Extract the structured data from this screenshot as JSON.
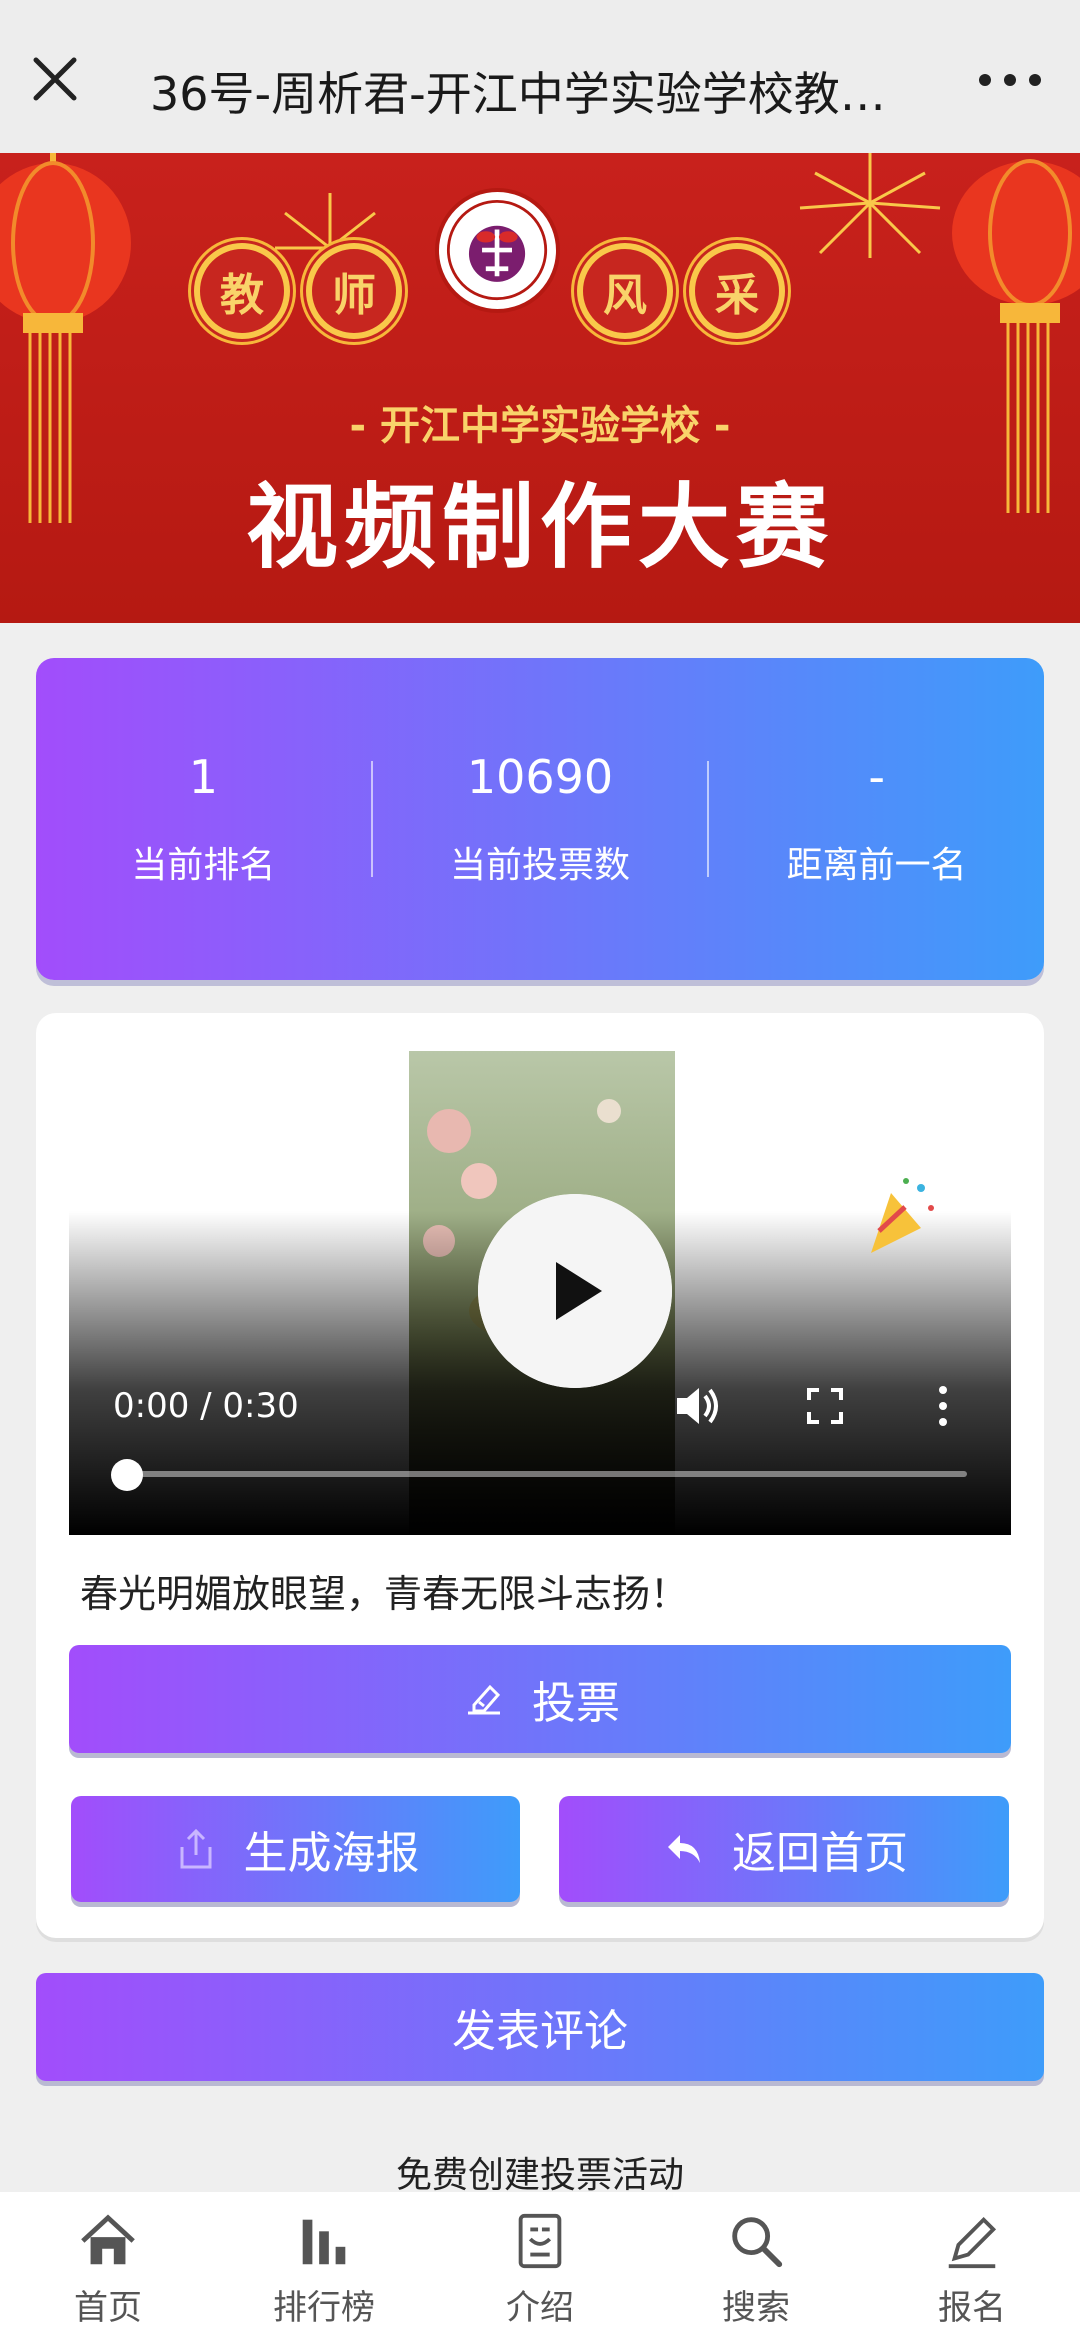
{
  "topbar": {
    "title": "36号-周析君-开江中学实验学校教师...",
    "close_icon": "close-icon",
    "more_icon": "more-icon"
  },
  "banner": {
    "words": [
      "教",
      "师",
      "风",
      "采"
    ],
    "school": "- 开江中学实验学校 -",
    "contest": "视频制作大赛"
  },
  "stats": {
    "rank_value": "1",
    "rank_label": "当前排名",
    "votes_value": "10690",
    "votes_label": "当前投票数",
    "gap_value": "-",
    "gap_label": "距离前一名"
  },
  "video": {
    "time": "0:00 / 0:30",
    "progress": 0
  },
  "caption": "春光明媚放眼望，青春无限斗志扬！",
  "buttons": {
    "vote": "投票",
    "poster": "生成海报",
    "home": "返回首页",
    "comment": "发表评论"
  },
  "free_text": "免费创建投票活动",
  "nav": [
    {
      "label": "首页",
      "icon": "home-icon"
    },
    {
      "label": "排行榜",
      "icon": "ranking-icon"
    },
    {
      "label": "介绍",
      "icon": "intro-icon"
    },
    {
      "label": "搜索",
      "icon": "search-icon"
    },
    {
      "label": "报名",
      "icon": "signup-pencil-icon"
    }
  ],
  "colors": {
    "gradient_start": "#a24dfb",
    "gradient_end": "#3e9cfa",
    "banner_red": "#c8211c",
    "banner_gold": "#f9d36a"
  }
}
